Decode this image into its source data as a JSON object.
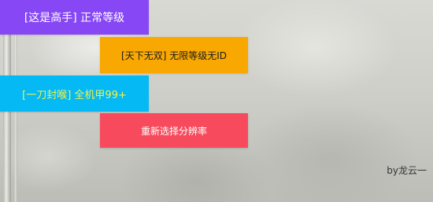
{
  "buttons": {
    "normal_level": "[这是高手] 正常等级",
    "unlimited_level": "[天下无双] 无限等级无ID",
    "full_armor": "[一刀封喉] 全机甲99+",
    "reselect_resolution": "重新选择分辨率"
  },
  "credit": "by龙云一",
  "colors": {
    "purple": "#8747f5",
    "orange": "#f8a800",
    "cyan": "#05b9f5",
    "red": "#f74b5d",
    "yellow_text": "#f2f24a"
  }
}
